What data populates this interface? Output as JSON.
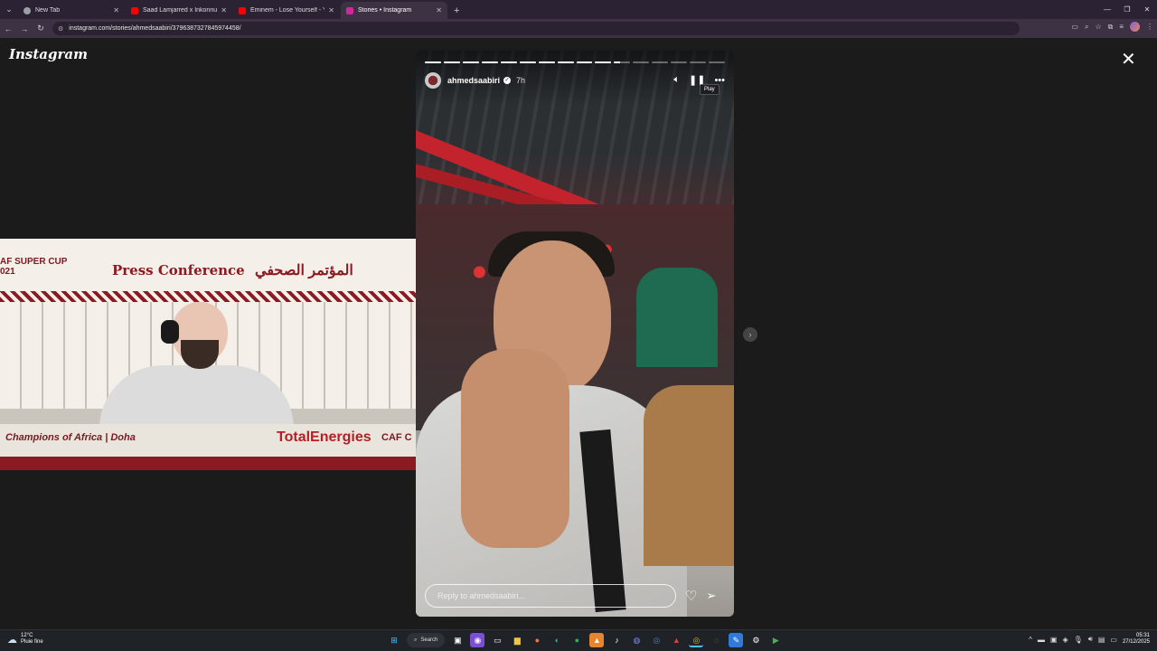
{
  "browser": {
    "tabs": [
      {
        "title": "New Tab",
        "favicon_color": "#9aa0a6",
        "active": false
      },
      {
        "title": "Saad Lamjarred x Inkonnu x Af",
        "favicon_color": "#ff0000",
        "active": false
      },
      {
        "title": "Eminem - Lose Yourself - YouTu",
        "favicon_color": "#ff0000",
        "active": false
      },
      {
        "title": "Stories • Instagram",
        "favicon_color": "#d6249f",
        "active": true
      }
    ],
    "url": "instagram.com/stories/ahmedsaabiri/3796387327845974458/"
  },
  "instagram": {
    "logo": "Instagram",
    "story": {
      "username": "ahmedsaabiri",
      "time_ago": "7h",
      "segments_total": 16,
      "segments_completed": 10,
      "current_segment_progress": 0.35,
      "tooltip": "Play",
      "reply_placeholder": "Reply to ahmedsaabiri..."
    }
  },
  "overlay_video": {
    "left_text": "AF SUPER CUP\n021",
    "title": "Press Conference",
    "arabic_title": "المؤتمر الصحفي",
    "bottom_left": "Champions of Africa  |  Doha",
    "sponsor": "TotalEnergies",
    "caf": "CAF C"
  },
  "taskbar": {
    "weather_temp": "12°C",
    "weather_desc": "Pluie fine",
    "search_label": "Search",
    "time": "05:31",
    "date": "27/12/2025"
  },
  "colors": {
    "accent_red": "#b22028",
    "page_bg": "#1b1b1b"
  }
}
